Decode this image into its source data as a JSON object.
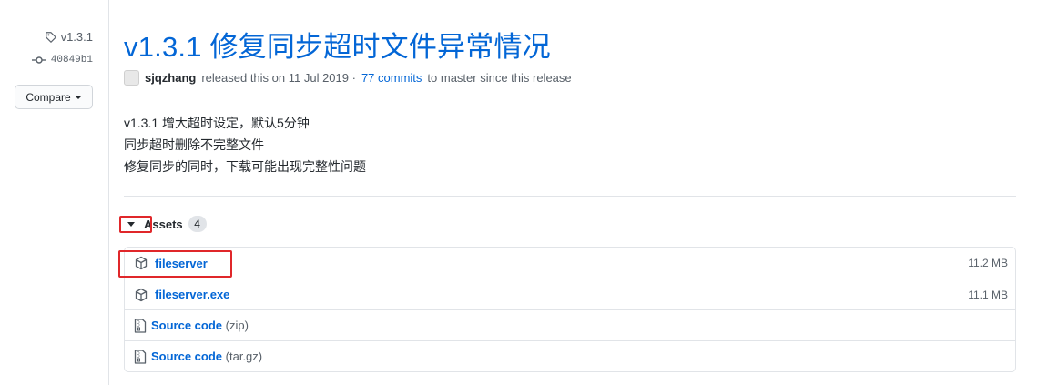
{
  "sidebar": {
    "tag": "v1.3.1",
    "commit": "40849b1",
    "compare_label": "Compare"
  },
  "release": {
    "title": "v1.3.1 修复同步超时文件异常情况",
    "author": "sjqzhang",
    "released_text": "released this on 11 Jul 2019 ·",
    "commits_link": "77 commits",
    "commits_suffix": "to master since this release",
    "notes": [
      "v1.3.1 增大超时设定，默认5分钟",
      "同步超时删除不完整文件",
      "修复同步的同时，下载可能出现完整性问题"
    ]
  },
  "assets": {
    "label": "Assets",
    "count": "4",
    "items": [
      {
        "name": "fileserver",
        "size": "11.2 MB",
        "icon": "package-icon"
      },
      {
        "name": "fileserver.exe",
        "size": "11.1 MB",
        "icon": "package-icon"
      },
      {
        "name": "Source code",
        "ext": "(zip)",
        "icon": "file-zip-icon"
      },
      {
        "name": "Source code",
        "ext": "(tar.gz)",
        "icon": "file-zip-icon"
      }
    ]
  },
  "colors": {
    "link": "#0366d6",
    "annotation": "#e0272a"
  }
}
